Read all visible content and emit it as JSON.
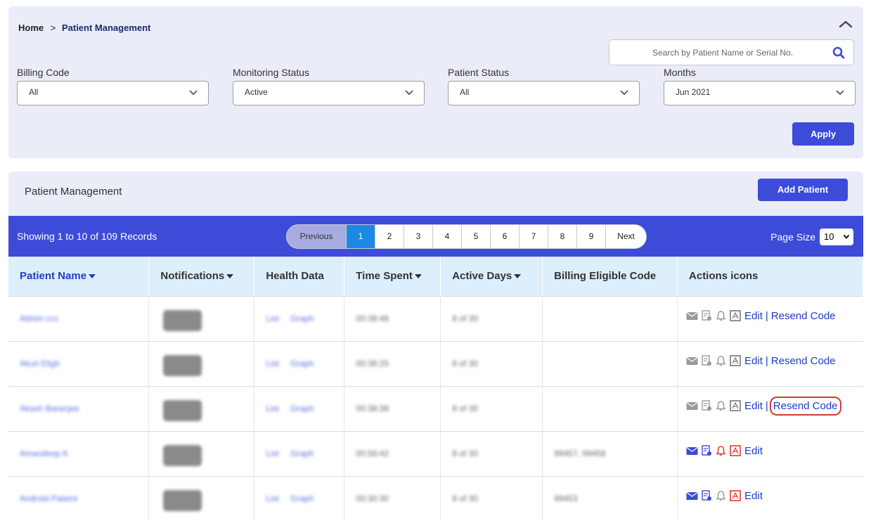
{
  "breadcrumb": {
    "home": "Home",
    "separator": ">",
    "current": "Patient Management"
  },
  "search": {
    "placeholder": "Search by Patient Name or Serial No."
  },
  "filters": [
    {
      "label": "Billing Code",
      "value": "All"
    },
    {
      "label": "Monitoring Status",
      "value": "Active"
    },
    {
      "label": "Patient Status",
      "value": "All"
    },
    {
      "label": "Months",
      "value": "Jun 2021"
    }
  ],
  "apply_label": "Apply",
  "panel": {
    "title": "Patient Management",
    "add_label": "Add Patient"
  },
  "pagination": {
    "records": "Showing 1 to 10 of 109 Records",
    "previous": "Previous",
    "pages": [
      "1",
      "2",
      "3",
      "4",
      "5",
      "6",
      "7",
      "8",
      "9"
    ],
    "next": "Next",
    "page_size_label": "Page Size",
    "page_size": "10"
  },
  "columns": [
    "Patient Name",
    "Notifications",
    "Health Data",
    "Time Spent",
    "Active Days",
    "Billing Eligible Code",
    "Actions icons"
  ],
  "health_links": {
    "list": "List",
    "graph": "Graph"
  },
  "actions": {
    "edit": "Edit",
    "separator": "|",
    "resend": "Resend Code"
  },
  "rows": [
    {
      "name": "Abhim ccc",
      "time": "00:38:48",
      "days": "8 of 30",
      "billing": "",
      "resend": true
    },
    {
      "name": "Akuri Eligh",
      "time": "00:38:25",
      "days": "8 of 30",
      "billing": "",
      "resend": true
    },
    {
      "name": "Akash Banerjee",
      "time": "00:38:38",
      "days": "8 of 30",
      "billing": "",
      "resend": true
    },
    {
      "name": "Amandeep K",
      "time": "00:58:42",
      "days": "8 of 30",
      "billing": "99457, 99458",
      "resend": false
    },
    {
      "name": "Android Patient",
      "time": "00:30:30",
      "days": "8 of 30",
      "billing": "99453",
      "resend": false
    }
  ],
  "colors": {
    "accent": "#3c4bd8",
    "header_bg": "#ddeefc",
    "panel_bg": "#eaecf8",
    "highlight": "#cf3b35"
  }
}
